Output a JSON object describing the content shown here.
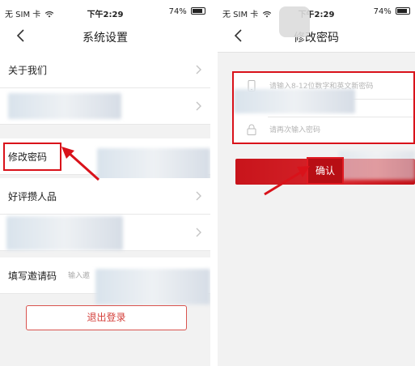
{
  "left_screen": {
    "status_bar": {
      "carrier": "无 SIM 卡",
      "time": "下午2:29",
      "battery": "74%"
    },
    "nav": {
      "title": "系统设置"
    },
    "rows": {
      "about": {
        "label": "关于我们"
      },
      "change_password": {
        "label": "修改密码"
      },
      "rate": {
        "label": "好评攒人品"
      },
      "invite_code": {
        "label": "填写邀请码",
        "hint": "输入邀"
      }
    },
    "logout_label": "退出登录"
  },
  "right_screen": {
    "status_bar": {
      "carrier": "无 SIM 卡",
      "time": "下午2:29",
      "battery": "74%"
    },
    "nav": {
      "title": "修改密码"
    },
    "form": {
      "new_password_placeholder": "请输入8-12位数字和英文新密码",
      "confirm_password_placeholder": "请再次输入密码"
    },
    "confirm_label": "确认"
  },
  "colors": {
    "accent": "#d9121a",
    "button_red": "#cc1a20",
    "outline_red": "#d9534f"
  }
}
